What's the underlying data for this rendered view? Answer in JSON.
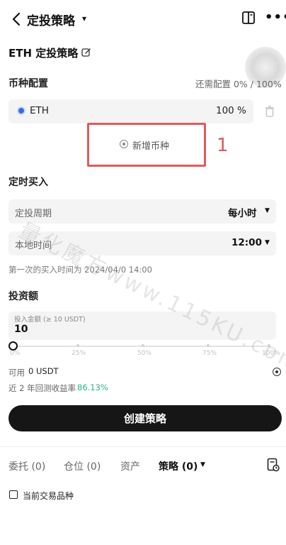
{
  "header": {
    "title": "定投策略",
    "caret": "▾",
    "more": "•••"
  },
  "strategy": {
    "name": "ETH 定投策略"
  },
  "coin_config": {
    "section_title": "币种配置",
    "need_config": "还需配置 0% / 100%",
    "coins": [
      {
        "symbol": "ETH",
        "percent": "100 %",
        "color": "#3b6dd8"
      }
    ],
    "add_label": "新增币种"
  },
  "annotation": {
    "label": "1",
    "color": "#e05b5b"
  },
  "timing": {
    "section_title": "定时买入",
    "period_label": "定投周期",
    "period_value": "每小时",
    "local_time_label": "本地时间",
    "local_time_value": "12:00",
    "first_buy_text": "第一次的买入时间为 2024/04/0 14:00"
  },
  "invest": {
    "section_title": "投资额",
    "amount_placeholder": "投入金额 (≥ 10 USDT)",
    "amount_value": "10",
    "slider_level": 0,
    "slider_ticks": [
      "0%",
      "25%",
      "50%",
      "75%",
      "100%"
    ]
  },
  "available": {
    "label": "可用",
    "value": "0 USDT"
  },
  "backtest": {
    "label": "近 2 年回测收益率",
    "value": "86.13%",
    "color": "#2bb38a"
  },
  "create_button": "创建策略",
  "bottom_tabs": [
    {
      "label": "委托 (0)"
    },
    {
      "label": "仓位 (0)"
    },
    {
      "label": "资产"
    },
    {
      "label": "策略 (0)"
    }
  ],
  "current_pair_label": "当前交易品种",
  "watermark": "量化魔方www.115KU.com",
  "icons": {
    "back": "chevron-left-icon",
    "book": "book-icon",
    "more": "more-icon",
    "edit": "edit-icon",
    "trash": "trash-icon",
    "add": "add-circle-icon",
    "orders": "orders-history-icon"
  }
}
